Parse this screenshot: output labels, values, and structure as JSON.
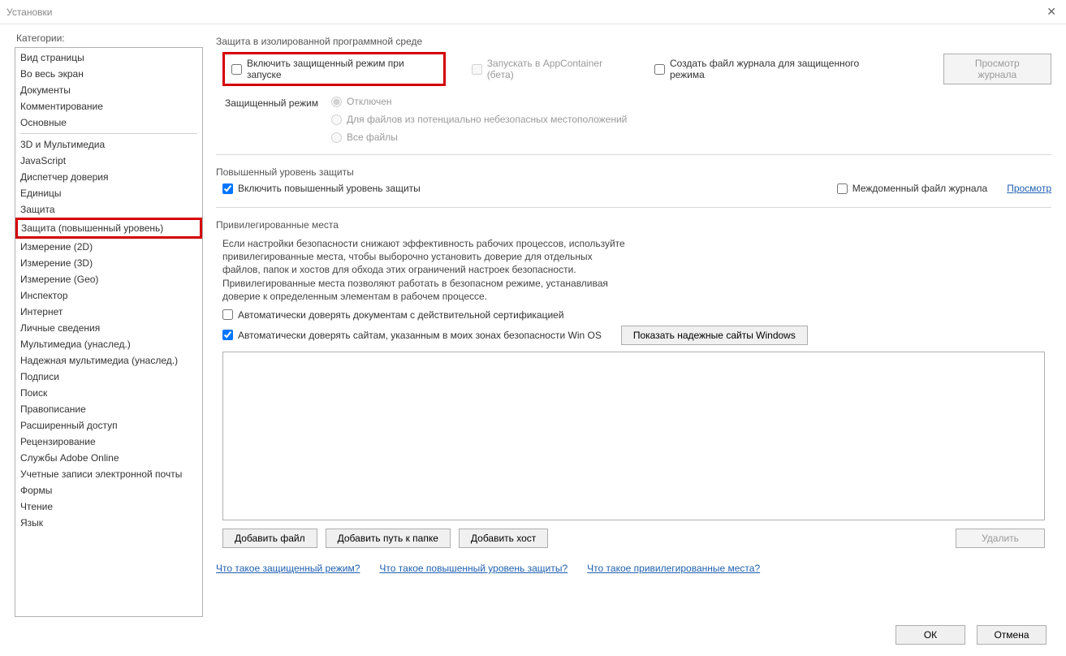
{
  "window": {
    "title": "Установки"
  },
  "categories": {
    "heading": "Категории:",
    "group1": [
      "Вид страницы",
      "Во весь экран",
      "Документы",
      "Комментирование",
      "Основные"
    ],
    "group2": [
      "3D и Мультимедиа",
      "JavaScript",
      "Диспетчер доверия",
      "Единицы",
      "Защита",
      "Защита (повышенный уровень)",
      "Измерение (2D)",
      "Измерение (3D)",
      "Измерение (Geo)",
      "Инспектор",
      "Интернет",
      "Личные сведения",
      "Мультимедиа (унаслед.)",
      "Надежная мультимедиа (унаслед.)",
      "Подписи",
      "Поиск",
      "Правописание",
      "Расширенный доступ",
      "Рецензирование",
      "Службы Adobe Online",
      "Учетные записи электронной почты",
      "Формы",
      "Чтение",
      "Язык"
    ],
    "selected": "Защита (повышенный уровень)"
  },
  "section_sandbox": {
    "title": "Защита в изолированной программной среде",
    "enable_protected": "Включить защищенный режим при запуске",
    "appcontainer": "Запускать в AppContainer (бета)",
    "create_log": "Создать файл журнала для защищенного режима",
    "view_log_btn": "Просмотр журнала",
    "mode_label": "Защищенный режим",
    "radio_off": "Отключен",
    "radio_unsafe": "Для файлов из потенциально небезопасных местоположений",
    "radio_all": "Все файлы"
  },
  "section_enhanced": {
    "title": "Повышенный уровень защиты",
    "enable_enhanced": "Включить повышенный уровень защиты",
    "crossdomain_log": "Междоменный файл журнала",
    "view_btn": "Просмотр"
  },
  "section_priv": {
    "title": "Привилегированные места",
    "description": "Если настройки безопасности снижают эффективность рабочих процессов, используйте привилегированные места, чтобы выборочно установить доверие для отдельных файлов, папок и хостов для обхода этих ограничений настроек безопасности. Привилегированные места позволяют работать в безопасном режиме, устанавливая доверие к определенным элементам в рабочем процессе.",
    "trust_cert": "Автоматически доверять документам с действительной сертификацией",
    "trust_winos": "Автоматически доверять сайтам, указанным в моих зонах безопасности Win OS",
    "show_trusted_btn": "Показать надежные сайты Windows",
    "add_file_btn": "Добавить файл",
    "add_folder_btn": "Добавить путь к папке",
    "add_host_btn": "Добавить хост",
    "delete_btn": "Удалить"
  },
  "help": {
    "protected": "Что такое защищенный режим?",
    "enhanced": "Что такое повышенный уровень защиты?",
    "priv": "Что такое привилегированные места?"
  },
  "footer": {
    "ok": "ОК",
    "cancel": "Отмена"
  }
}
